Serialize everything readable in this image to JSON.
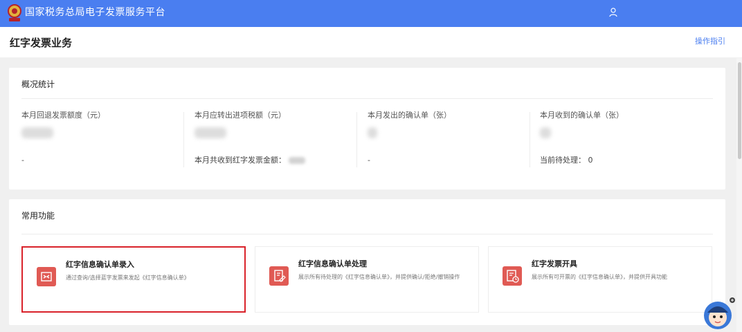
{
  "header": {
    "app_title": "国家税务总局电子发票服务平台",
    "user_icon": "user-icon",
    "emblem_icon": "tax-emblem-icon"
  },
  "page": {
    "title": "红字发票业务",
    "guide_link": "操作指引"
  },
  "stats": {
    "title": "概况统计",
    "items": [
      {
        "label": "本月回退发票额度（元）",
        "sub": "-"
      },
      {
        "label": "本月应转出进项税额（元）",
        "sub": "本月共收到红字发票金额："
      },
      {
        "label": "本月发出的确认单（张）",
        "sub": "-"
      },
      {
        "label": "本月收到的确认单（张）",
        "sub": "当前待处理：  0"
      }
    ]
  },
  "functions": {
    "title": "常用功能",
    "tiles": [
      {
        "name": "红字信息确认单录入",
        "desc": "通过查询/选择蓝字发票来发起《红字信息确认单》",
        "icon": "transfer-icon"
      },
      {
        "name": "红字信息确认单处理",
        "desc": "展示所有待处理的《红字信息确认单》，并提供确认/拒绝/撤销操作",
        "icon": "document-edit-icon"
      },
      {
        "name": "红字发票开具",
        "desc": "展示所有可开票的《红字信息确认单》，并提供开具功能",
        "icon": "invoice-clock-icon"
      }
    ]
  },
  "colors": {
    "topbar": "#4a7ef0",
    "accent_red": "#d9222a",
    "icon_bg": "#e05a54"
  },
  "assistant_icon": "assistant-mascot-icon"
}
